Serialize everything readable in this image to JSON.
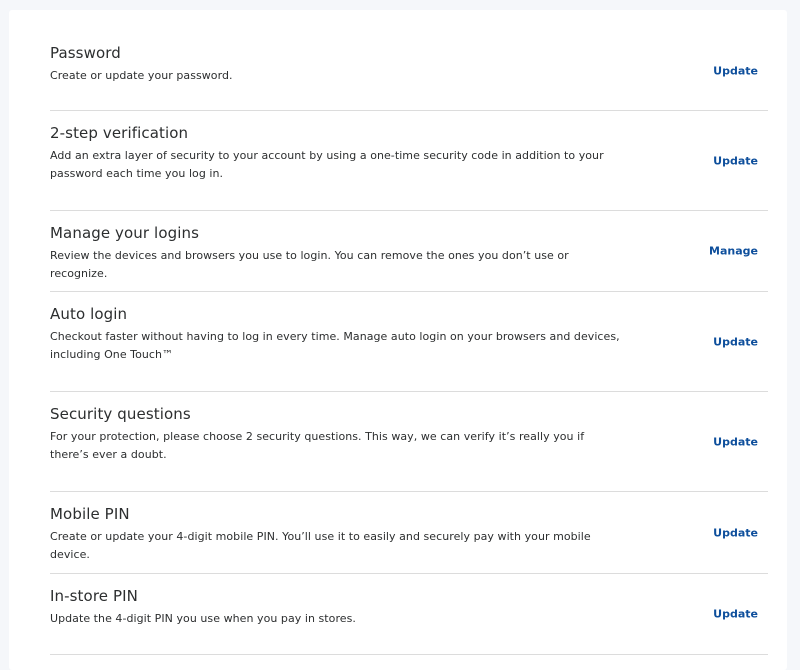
{
  "settings": {
    "items": [
      {
        "title": "Password",
        "description": "Create or update your password.",
        "action": "Update"
      },
      {
        "title": "2-step verification",
        "description": "Add an extra layer of security to your account by using a one-time security code in addition to your password each time you log in.",
        "action": "Update"
      },
      {
        "title": "Manage your logins",
        "description": "Review the devices and browsers you use to login. You can remove the ones you don’t use or recognize.",
        "action": "Manage"
      },
      {
        "title": "Auto login",
        "description": "Checkout faster without having to log in every time. Manage auto login on your browsers and devices, including One Touch™",
        "action": "Update"
      },
      {
        "title": "Security questions",
        "description": "For your protection, please choose 2 security questions. This way, we can verify it’s really you if there’s ever a doubt.",
        "action": "Update"
      },
      {
        "title": "Mobile PIN",
        "description": "Create or update your 4-digit mobile PIN. You’ll use it to easily and securely pay with your mobile device.",
        "action": "Update"
      },
      {
        "title": "In-store PIN",
        "description": "Update the 4-digit PIN you use when you pay in stores.",
        "action": "Update"
      }
    ]
  },
  "colors": {
    "link": "#0e4f9c",
    "text": "#2c2e2f",
    "divider": "#dcdcdc",
    "page_background": "#f5f7fa"
  }
}
